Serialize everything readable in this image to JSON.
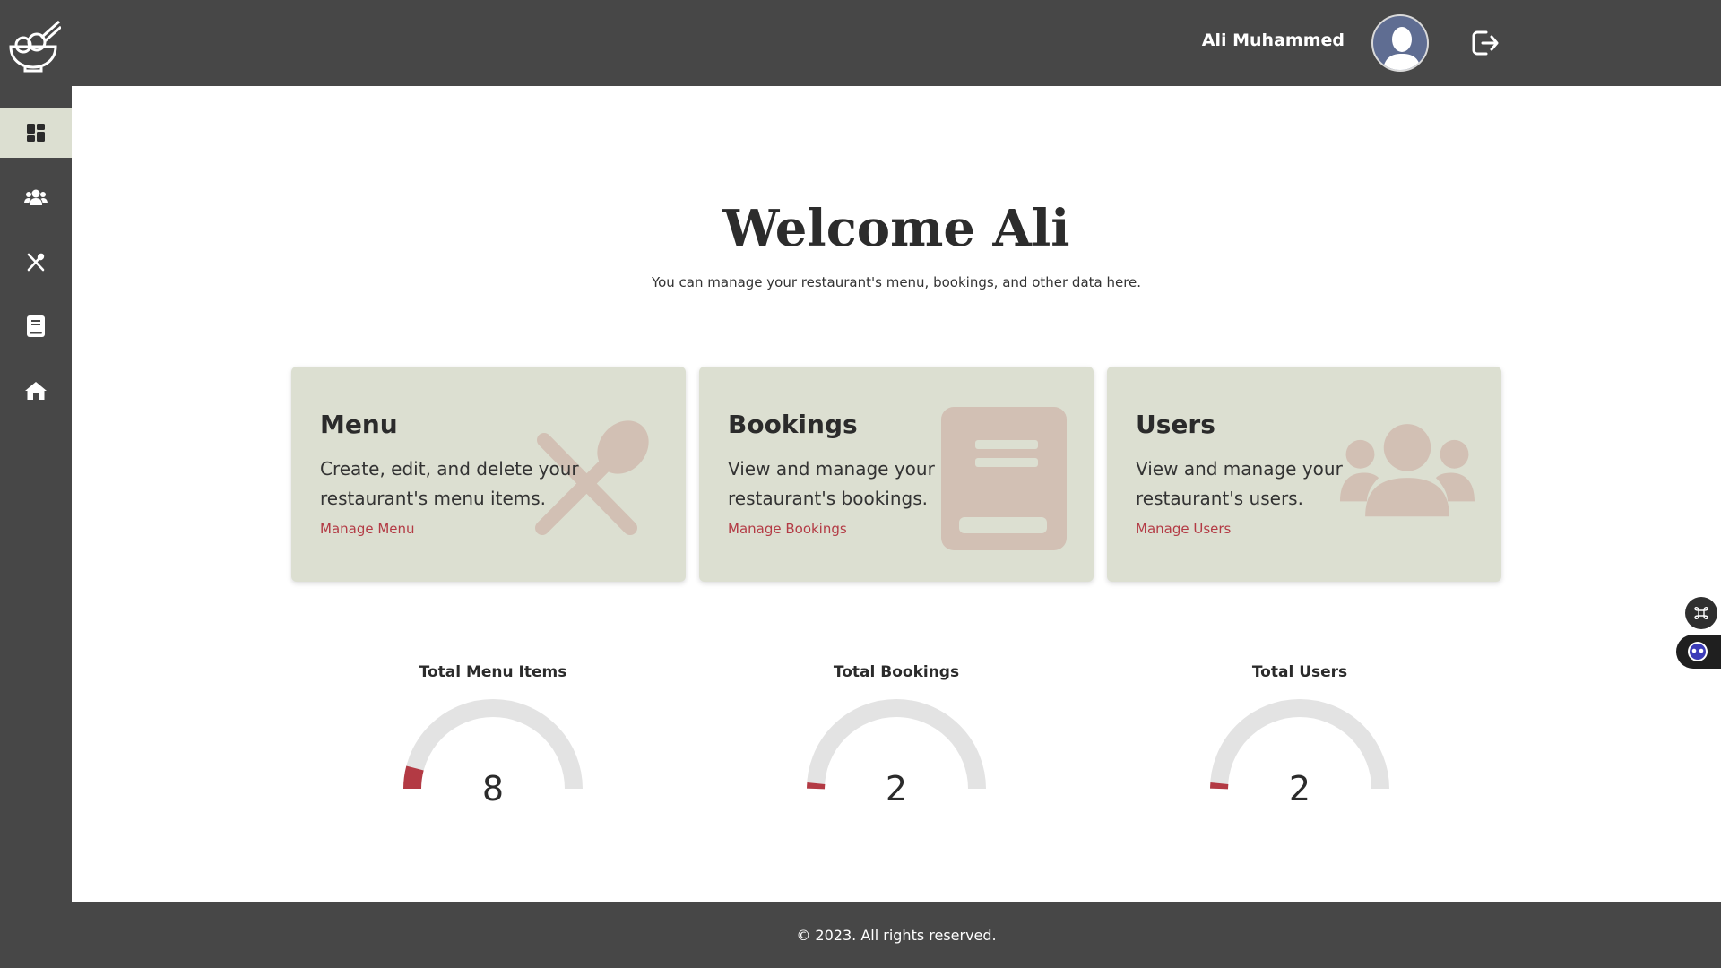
{
  "header": {
    "user_name": "Ali Muhammed"
  },
  "sidebar": {
    "items": [
      {
        "icon": "dashboard-icon",
        "active": true
      },
      {
        "icon": "users-icon",
        "active": false
      },
      {
        "icon": "utensils-icon",
        "active": false
      },
      {
        "icon": "book-icon",
        "active": false
      },
      {
        "icon": "home-icon",
        "active": false
      }
    ]
  },
  "main": {
    "title": "Welcome Ali",
    "subtitle": "You can manage your restaurant's menu, bookings, and other data here.",
    "cards": [
      {
        "title": "Menu",
        "description": "Create, edit, and delete your restaurant's menu items.",
        "link": "Manage Menu",
        "icon": "utensils-icon"
      },
      {
        "title": "Bookings",
        "description": "View and manage your restaurant's bookings.",
        "link": "Manage Bookings",
        "icon": "book-icon"
      },
      {
        "title": "Users",
        "description": "View and manage your restaurant's users.",
        "link": "Manage Users",
        "icon": "users-icon"
      }
    ],
    "stats": [
      {
        "label": "Total Menu Items",
        "value": "8"
      },
      {
        "label": "Total Bookings",
        "value": "2"
      },
      {
        "label": "Total Users",
        "value": "2"
      }
    ]
  },
  "footer": {
    "text": "© 2023. All rights reserved."
  },
  "colors": {
    "dark": "#474747",
    "card": "#dcdfd1",
    "accent": "#b33a44",
    "gauge_track": "#e3e3e3"
  }
}
